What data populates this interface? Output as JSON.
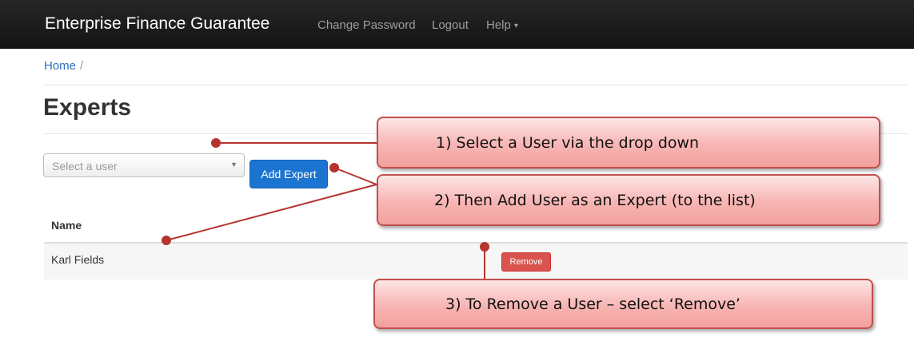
{
  "navbar": {
    "brand": "Enterprise Finance Guarantee",
    "links": {
      "change_password": "Change Password",
      "logout": "Logout",
      "help": "Help"
    },
    "background": "#1e1e1e"
  },
  "breadcrumb": {
    "home": "Home",
    "separator": "/"
  },
  "page": {
    "title": "Experts"
  },
  "form": {
    "select_placeholder": "Select a user",
    "add_button": "Add Expert"
  },
  "table": {
    "headers": {
      "name": "Name"
    },
    "rows": [
      {
        "name": "Karl Fields",
        "action": "Remove"
      }
    ]
  },
  "callouts": {
    "step1": "1)  Select a User via the drop down",
    "step2": "2)  Then Add User as an Expert (to the list)",
    "step3": "3)  To Remove a User – select ‘Remove’"
  },
  "colors": {
    "accent_blue": "#1b75d0",
    "danger_red": "#d9534f",
    "callout_border": "#c0504d",
    "link": "#2f6fbf"
  },
  "icons": {
    "help_caret": "caret-down",
    "select_arrow": "triangle-down"
  }
}
